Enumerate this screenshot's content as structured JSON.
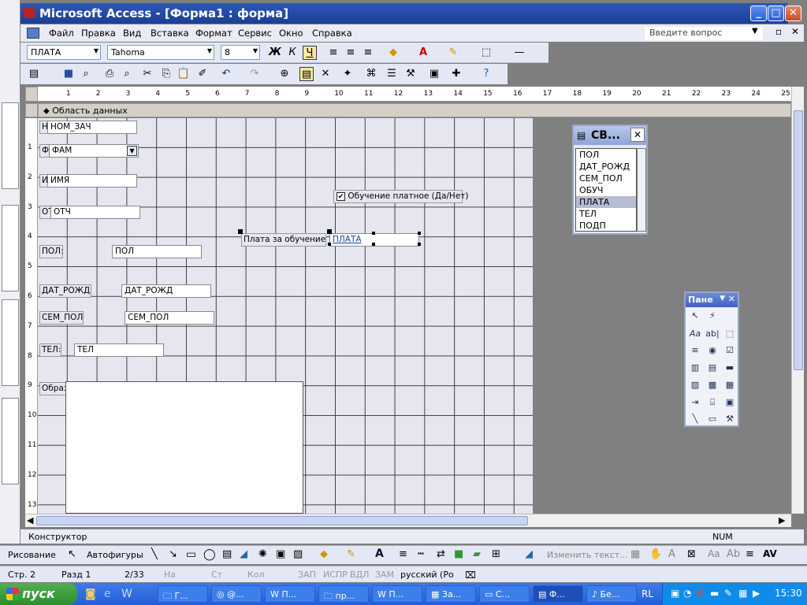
{
  "window": {
    "title": "Microsoft Access - [Форма1 : форма]"
  },
  "menu": {
    "items": [
      "Файл",
      "Правка",
      "Вид",
      "Вставка",
      "Формат",
      "Сервис",
      "Окно",
      "Справка"
    ],
    "help_placeholder": "Введите вопрос"
  },
  "toolbar": {
    "object_combo": "ПЛАТА",
    "font_combo": "Tahoma",
    "size_combo": "8"
  },
  "ruler": {
    "marks": [
      "1",
      "2",
      "3",
      "4",
      "5",
      "6",
      "7",
      "8",
      "9",
      "10",
      "11",
      "12",
      "13",
      "14",
      "15",
      "16",
      "17",
      "18",
      "19",
      "20",
      "21",
      "22",
      "23",
      "24",
      "25"
    ]
  },
  "vruler": {
    "marks": [
      "1",
      "2",
      "3",
      "4",
      "5",
      "6",
      "7",
      "8",
      "9",
      "10",
      "11",
      "12",
      "13"
    ]
  },
  "section": {
    "label": "Область данных"
  },
  "form": {
    "labels": {
      "nom": "Н",
      "fam": "Ф",
      "imya": "И",
      "otch": "ОТ",
      "pol": "ПОЛ:",
      "dat": "ДАТ_РОЖД:",
      "sem": "СЕМ_ПОЛ:",
      "tel": "ТЕЛ:",
      "obraz": "Образ",
      "plata": "Плата за обучение:"
    },
    "fields": {
      "nom": "НОМ_ЗАЧ",
      "fam": "ФАМ",
      "imya": "ИМЯ",
      "otch": "ОТЧ",
      "pol": "ПОЛ",
      "dat": "ДАТ_РОЖД",
      "sem": "СЕМ_ПОЛ",
      "tel": "ТЕЛ",
      "plata": "ПЛАТА"
    },
    "checkbox": {
      "label": "Обучение платное (Да/Нет)",
      "checked": true
    }
  },
  "field_list": {
    "title": "СВ...",
    "items": [
      "ПОЛ",
      "ДАТ_РОЖД",
      "СЕМ_ПОЛ",
      "ОБУЧ",
      "ПЛАТА",
      "ТЕЛ",
      "ПОДП"
    ],
    "selected": "ПЛАТА"
  },
  "toolbox": {
    "title": "Пане"
  },
  "status": {
    "mode": "Конструктор",
    "num": "NUM"
  },
  "drawing": {
    "draw": "Рисование",
    "autoshapes": "Автофигуры",
    "edit_text": "Изменить текст..."
  },
  "word_status": {
    "page": "Стр. 2",
    "section": "Разд 1",
    "pages": "2/33",
    "at": "На",
    "ln": "Ст",
    "col": "Кол",
    "rec": "ЗАП",
    "trk": "ИСПР",
    "ext": "ВДЛ",
    "ovr": "ЗАМ",
    "lang": "русский (Ро"
  },
  "taskbar": {
    "start": "пуск",
    "tasks": [
      "Г...",
      "@...",
      "П...",
      "пр...",
      "П...",
      "За...",
      "С...",
      "Ф...",
      "Бе..."
    ],
    "lang": "RL",
    "clock": "15:30"
  }
}
